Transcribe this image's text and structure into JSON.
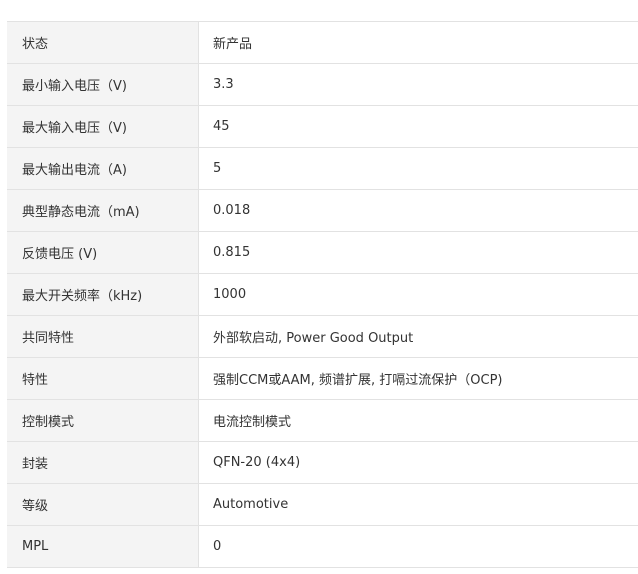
{
  "specs": [
    {
      "label": "状态",
      "value": "新产品"
    },
    {
      "label": "最小输入电压（V)",
      "value": "3.3"
    },
    {
      "label": "最大输入电压（V)",
      "value": "45"
    },
    {
      "label": "最大输出电流（A)",
      "value": "5"
    },
    {
      "label": "典型静态电流（mA)",
      "value": "0.018"
    },
    {
      "label": "反馈电压 (V)",
      "value": "0.815"
    },
    {
      "label": "最大开关频率（kHz)",
      "value": "1000"
    },
    {
      "label": "共同特性",
      "value": "外部软启动, Power Good Output"
    },
    {
      "label": "特性",
      "value": "强制CCM或AAM, 频谱扩展, 打嗝过流保护（OCP)"
    },
    {
      "label": "控制模式",
      "value": "电流控制模式"
    },
    {
      "label": "封装",
      "value": "QFN-20 (4x4)"
    },
    {
      "label": "等级",
      "value": "Automotive"
    },
    {
      "label": "MPL",
      "value": "0"
    }
  ]
}
